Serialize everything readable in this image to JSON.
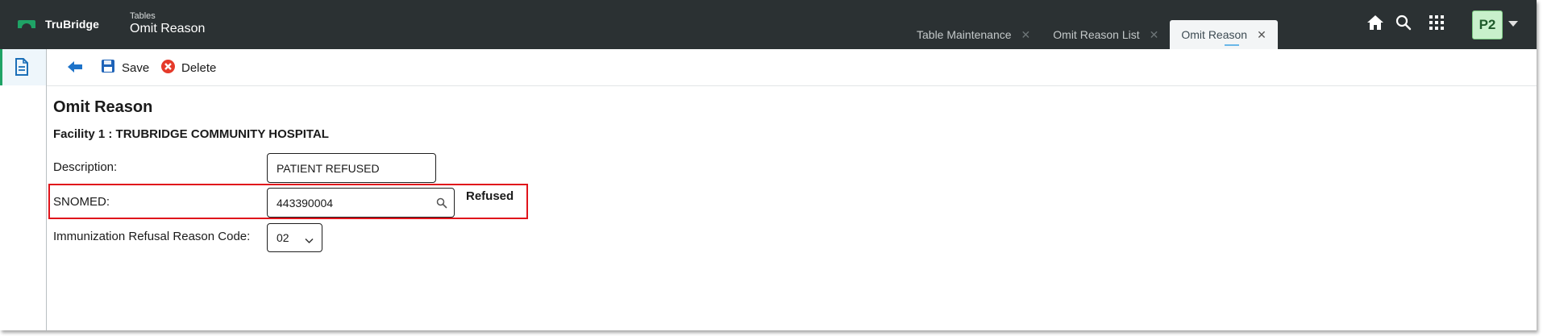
{
  "app": {
    "brand": "TruBridge",
    "breadcrumb": "Tables",
    "title": "Omit Reason"
  },
  "tabs": [
    {
      "label": "Table Maintenance",
      "active": false
    },
    {
      "label": "Omit Reason List",
      "active": false
    },
    {
      "label": "Omit Reason",
      "active": true
    }
  ],
  "header_icons": [
    "home-icon",
    "search-icon",
    "apps-grid-icon"
  ],
  "user": {
    "initials": "P2"
  },
  "toolbar": {
    "back_icon": "back-arrow-icon",
    "save_label": "Save",
    "delete_label": "Delete"
  },
  "form": {
    "heading": "Omit Reason",
    "facility": "Facility 1 : TRUBRIDGE COMMUNITY HOSPITAL",
    "description_label": "Description:",
    "description_value": "PATIENT REFUSED",
    "snomed_label": "SNOMED:",
    "snomed_value": "443390004",
    "snomed_text": "Refused",
    "refusal_label": "Immunization Refusal Reason Code:",
    "refusal_value": "02"
  },
  "colors": {
    "topbar": "#2b3133",
    "brand_green": "#1fa366",
    "highlight_red": "#e0141b",
    "avatar_bg": "#c8f0cb"
  }
}
